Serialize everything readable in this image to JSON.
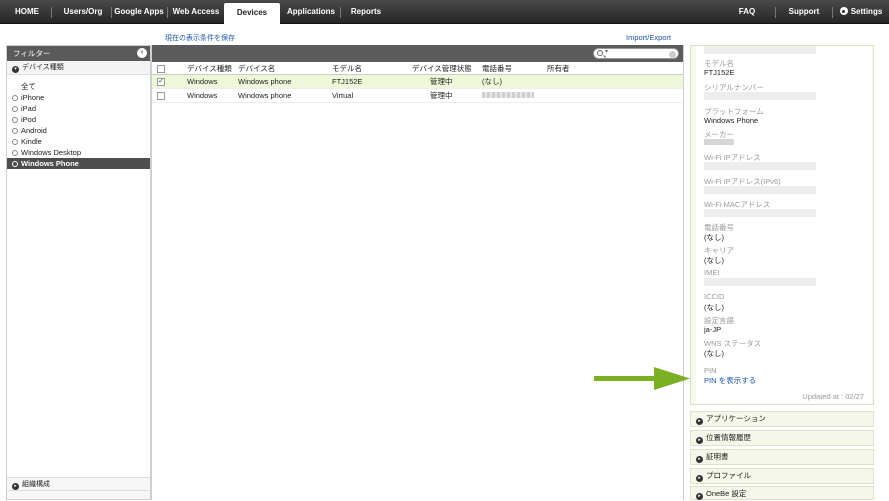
{
  "nav": {
    "tabs": [
      {
        "label": "HOME"
      },
      {
        "label": "Users/Org"
      },
      {
        "label": "Google Apps"
      },
      {
        "label": "Web Access"
      },
      {
        "label": "Devices"
      },
      {
        "label": "Applications"
      },
      {
        "label": "Reports"
      }
    ],
    "active_tab": "Devices",
    "right": {
      "faq": "FAQ",
      "support": "Support",
      "settings": "Settings"
    }
  },
  "filter": {
    "title": "フィルター",
    "section": "デバイス種類",
    "items": [
      "全て",
      "iPhone",
      "iPad",
      "iPod",
      "Android",
      "Kindle",
      "Windows Desktop",
      "Windows Phone"
    ],
    "selected": "Windows Phone",
    "bottom_section": "組織構成"
  },
  "links": {
    "save_view": "現在の表示条件を保存",
    "import_export": "Import/Export"
  },
  "grid": {
    "columns": [
      "デバイス種類",
      "デバイス名",
      "モデル名",
      "デバイス管理状態",
      "電話番号",
      "所有者"
    ],
    "rows": [
      {
        "type": "Windows",
        "name": "Windows phone",
        "model": "FTJ152E",
        "status": "管理中",
        "phone": "(なし)",
        "owner": "",
        "checked": true
      },
      {
        "type": "Windows",
        "name": "Windows phone",
        "model": "Virtual",
        "status": "管理中",
        "phone": "",
        "owner": "",
        "checked": false
      }
    ]
  },
  "detail": {
    "model_label": "モデル名",
    "model_value": "FTJ152E",
    "serial_label": "シリアルナンバー",
    "platform_label": "プラットフォーム",
    "platform_value": "Windows Phone",
    "maker_label": "メーカー",
    "wifi_ip_label": "Wi-Fi IPアドレス",
    "wifi_ipv6_label": "Wi-Fi IPアドレス(IPv6)",
    "wifi_mac_label": "Wi-Fi MACアドレス",
    "phone_label": "電話番号",
    "phone_value": "(なし)",
    "carrier_label": "キャリア",
    "carrier_value": "(なし)",
    "imei_label": "IMEI",
    "iccid_label": "ICCID",
    "iccid_value": "(なし)",
    "lang_label": "設定言語",
    "lang_value": "ja-JP",
    "wns_label": "WNS ステータス",
    "wns_value": "(なし)",
    "pin_label": "PIN",
    "pin_link": "PIN を表示する",
    "updated": "Updated at : 02/27"
  },
  "accordions": [
    "アプリケーション",
    "位置情報履歴",
    "証明書",
    "プロファイル",
    "OneBe 設定"
  ],
  "colors": {
    "nav_dark": "#262626",
    "selected_row": "#eef7d8",
    "link": "#1a58b0",
    "arrow": "#7bb024"
  }
}
